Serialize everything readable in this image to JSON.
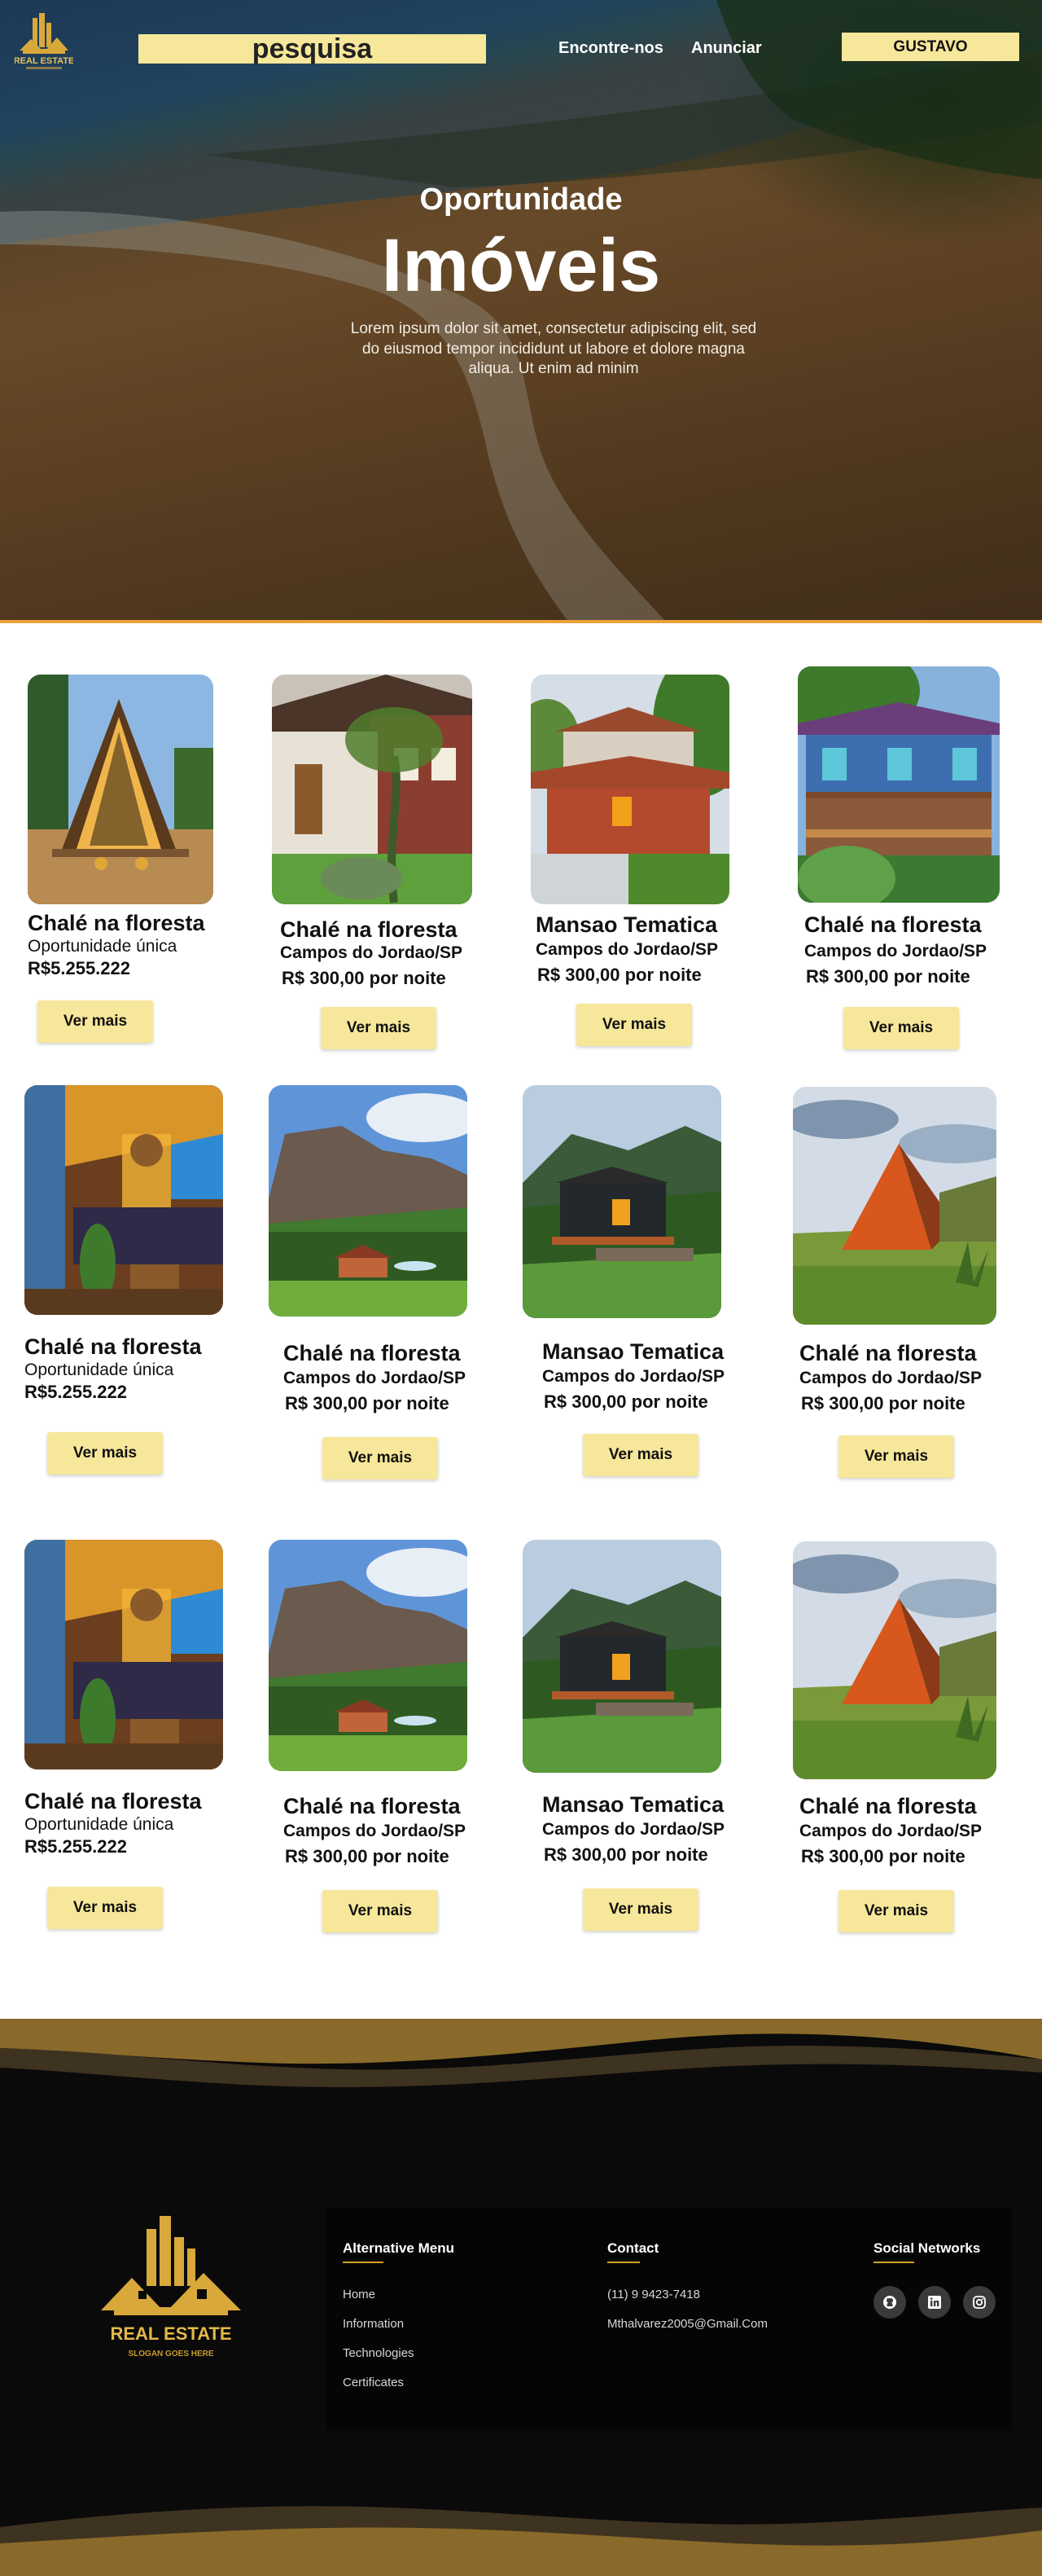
{
  "header": {
    "search_placeholder": "pesquisa",
    "nav": [
      "Encontre-nos",
      "Anunciar"
    ],
    "user_button": "GUSTAVO",
    "logo_text": "REAL ESTATE"
  },
  "hero": {
    "subtitle": "Oportunidade",
    "title": "Imóveis",
    "text": "Lorem ipsum dolor sit amet, consectetur adipiscing elit, sed do eiusmod tempor incididunt ut labore et dolore magna aliqua. Ut enim ad minim"
  },
  "listings": [
    [
      {
        "title": "Chalé na floresta",
        "line2": "Oportunidade única",
        "line3": "R$5.255.222",
        "button": "Ver mais",
        "image": "a-frame-chalet"
      },
      {
        "title": "Chalé na floresta",
        "line2": "Campos do Jordao/SP",
        "line3": "R$ 300,00 por noite",
        "button": "Ver mais",
        "image": "wooden-house-garden"
      },
      {
        "title": "Mansao Tematica",
        "line2": "Campos do Jordao/SP",
        "line3": "R$ 300,00 por noite",
        "button": "Ver mais",
        "image": "red-tile-house"
      },
      {
        "title": "Chalé na floresta",
        "line2": "Campos do Jordao/SP",
        "line3": "R$ 300,00 por noite",
        "button": "Ver mais",
        "image": "blue-wooden-lodge"
      }
    ],
    [
      {
        "title": "Chalé na floresta",
        "line2": "Oportunidade única",
        "line3": "R$5.255.222",
        "button": "Ver mais",
        "image": "wooden-interior"
      },
      {
        "title": "Chalé na floresta",
        "line2": "Campos do Jordao/SP",
        "line3": "R$ 300,00 por noite",
        "button": "Ver mais",
        "image": "mountain-valley-house"
      },
      {
        "title": "Mansao Tematica",
        "line2": "Campos do Jordao/SP",
        "line3": "R$ 300,00 por noite",
        "button": "Ver mais",
        "image": "dark-chalet-mountains"
      },
      {
        "title": "Chalé na floresta",
        "line2": "Campos do Jordao/SP",
        "line3": "R$ 300,00 por noite",
        "button": "Ver mais",
        "image": "orange-a-frame"
      }
    ],
    [
      {
        "title": "Chalé na floresta",
        "line2": "Oportunidade única",
        "line3": "R$5.255.222",
        "button": "Ver mais",
        "image": "wooden-interior"
      },
      {
        "title": "Chalé na floresta",
        "line2": "Campos do Jordao/SP",
        "line3": "R$ 300,00 por noite",
        "button": "Ver mais",
        "image": "mountain-valley-house"
      },
      {
        "title": "Mansao Tematica",
        "line2": "Campos do Jordao/SP",
        "line3": "R$ 300,00 por noite",
        "button": "Ver mais",
        "image": "dark-chalet-mountains"
      },
      {
        "title": "Chalé na floresta",
        "line2": "Campos do Jordao/SP",
        "line3": "R$ 300,00 por noite",
        "button": "Ver mais",
        "image": "orange-a-frame"
      }
    ]
  ],
  "footer": {
    "logo_text": "REAL ESTATE",
    "logo_slogan": "SLOGAN GOES HERE",
    "menu_title": "Alternative Menu",
    "menu_items": [
      "Home",
      "Information",
      "Technologies",
      "Certificates"
    ],
    "contact_title": "Contact",
    "contact_items": [
      "(11) 9 9423-7418",
      "Mthalvarez2005@Gmail.Com"
    ],
    "social_title": "Social Networks",
    "social_icons": [
      "github-icon",
      "linkedin-icon",
      "instagram-icon"
    ]
  },
  "colors": {
    "accent": "#f7e79a",
    "gold": "#d4a02a",
    "footer_bg": "#0a0a0a"
  }
}
